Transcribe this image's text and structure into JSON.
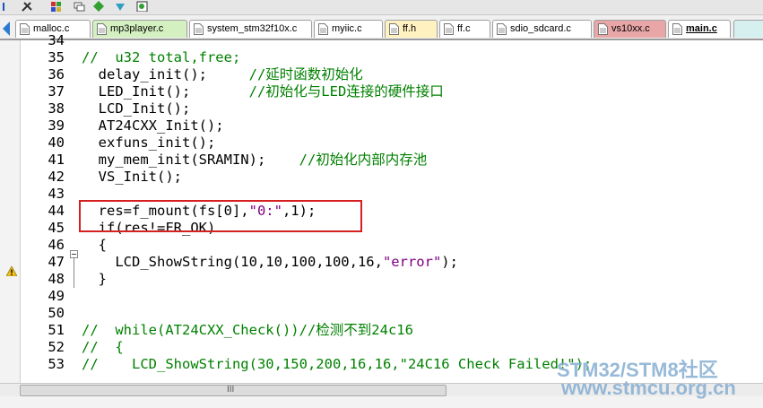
{
  "tabs": [
    {
      "label": "malloc.c",
      "color": "#ffffff"
    },
    {
      "label": "mp3player.c",
      "color": "#d4f0c0"
    },
    {
      "label": "system_stm32f10x.c",
      "color": "#ffffff"
    },
    {
      "label": "myiic.c",
      "color": "#ffffff"
    },
    {
      "label": "ff.h",
      "color": "#fff2c0"
    },
    {
      "label": "ff.c",
      "color": "#ffffff"
    },
    {
      "label": "sdio_sdcard.c",
      "color": "#ffffff"
    },
    {
      "label": "vs10xx.c",
      "color": "#e8a6a6"
    },
    {
      "label": "main.c",
      "color": "#ffffff",
      "active": true
    }
  ],
  "code": [
    {
      "n": "34",
      "t": ""
    },
    {
      "n": "35",
      "t": "//  u32 total,free;"
    },
    {
      "n": "36",
      "t": "  delay_init();     //延时函数初始化"
    },
    {
      "n": "37",
      "t": "  LED_Init();       //初始化与LED连接的硬件接口"
    },
    {
      "n": "38",
      "t": "  LCD_Init();"
    },
    {
      "n": "39",
      "t": "  AT24CXX_Init();"
    },
    {
      "n": "40",
      "t": "  exfuns_init();"
    },
    {
      "n": "41",
      "t": "  my_mem_init(SRAMIN);    //初始化内部内存池"
    },
    {
      "n": "42",
      "t": "  VS_Init();"
    },
    {
      "n": "43",
      "t": ""
    },
    {
      "n": "44",
      "t": "  res=f_mount(fs[0],\"0:\",1);"
    },
    {
      "n": "45",
      "t": "  if(res!=FR_OK)"
    },
    {
      "n": "46",
      "t": "  {"
    },
    {
      "n": "47",
      "t": "    LCD_ShowString(10,10,100,100,16,\"error\");"
    },
    {
      "n": "48",
      "t": "  }"
    },
    {
      "n": "49",
      "t": ""
    },
    {
      "n": "50",
      "t": ""
    },
    {
      "n": "51",
      "t": "//  while(AT24CXX_Check())//检测不到24c16"
    },
    {
      "n": "52",
      "t": "//  {"
    },
    {
      "n": "53",
      "t": "//    LCD_ShowString(30,150,200,16,16,\"24C16 Check Failed!\");"
    }
  ],
  "watermark": {
    "line1": "STM32/STM8社区",
    "line2": "www.stmcu.org.cn"
  },
  "scroll_grip": "III",
  "colors": {
    "comment": "#008000",
    "string": "#800080",
    "highlight": "#d42020"
  }
}
